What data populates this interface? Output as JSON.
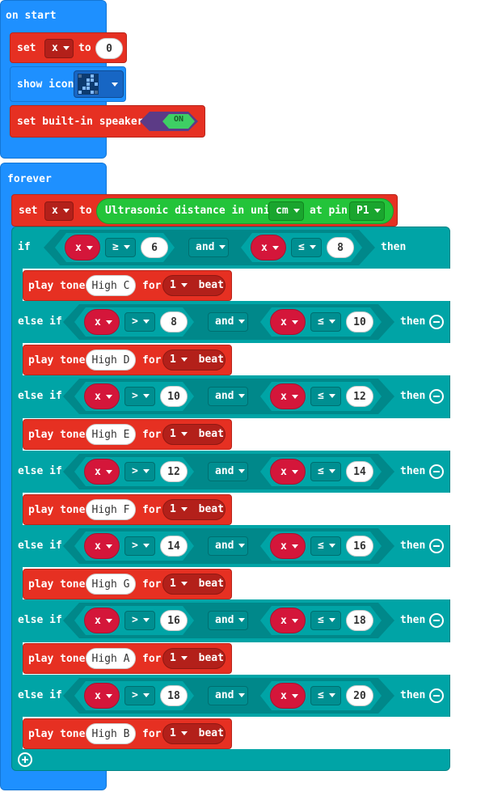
{
  "on_start": {
    "hat_label": "on start",
    "set_label": "set",
    "var_name": "x",
    "to_label": "to",
    "value": "0",
    "show_icon_label": "show icon",
    "speaker_label": "set built-in speaker",
    "speaker_state": "ON"
  },
  "forever": {
    "hat_label": "forever",
    "set_label": "set",
    "var_name": "x",
    "to_label": "to",
    "sensor_label": "Ultrasonic distance in unit",
    "unit": "cm",
    "at_pin_label": "at pin",
    "pin": "P1"
  },
  "conditions": [
    {
      "keyword": "if",
      "var1": "x",
      "op1": "≥",
      "val1": "6",
      "logic": "and",
      "var2": "x",
      "op2": "≤",
      "val2": "8",
      "then": "then",
      "tone": "High C",
      "beats": "1"
    },
    {
      "keyword": "else if",
      "var1": "x",
      "op1": ">",
      "val1": "8",
      "logic": "and",
      "var2": "x",
      "op2": "≤",
      "val2": "10",
      "then": "then",
      "tone": "High D",
      "beats": "1"
    },
    {
      "keyword": "else if",
      "var1": "x",
      "op1": ">",
      "val1": "10",
      "logic": "and",
      "var2": "x",
      "op2": "≤",
      "val2": "12",
      "then": "then",
      "tone": "High E",
      "beats": "1"
    },
    {
      "keyword": "else if",
      "var1": "x",
      "op1": ">",
      "val1": "12",
      "logic": "and",
      "var2": "x",
      "op2": "≤",
      "val2": "14",
      "then": "then",
      "tone": "High F",
      "beats": "1"
    },
    {
      "keyword": "else if",
      "var1": "x",
      "op1": ">",
      "val1": "14",
      "logic": "and",
      "var2": "x",
      "op2": "≤",
      "val2": "16",
      "then": "then",
      "tone": "High G",
      "beats": "1"
    },
    {
      "keyword": "else if",
      "var1": "x",
      "op1": ">",
      "val1": "16",
      "logic": "and",
      "var2": "x",
      "op2": "≤",
      "val2": "18",
      "then": "then",
      "tone": "High A",
      "beats": "1"
    },
    {
      "keyword": "else if",
      "var1": "x",
      "op1": ">",
      "val1": "18",
      "logic": "and",
      "var2": "x",
      "op2": "≤",
      "val2": "20",
      "then": "then",
      "tone": "High B",
      "beats": "1"
    }
  ],
  "labels": {
    "play_tone": "play tone",
    "for": "for",
    "beat": "beat"
  },
  "colors": {
    "event_blue": "#1e90ff",
    "variable_red": "#e63022",
    "logic_teal": "#00a4a6",
    "sensor_green": "#23c43a"
  },
  "icons": {
    "show_icon_image": "led-grid-icon",
    "remove_branch": "minus-circle-icon",
    "add_branch": "plus-circle-icon"
  }
}
